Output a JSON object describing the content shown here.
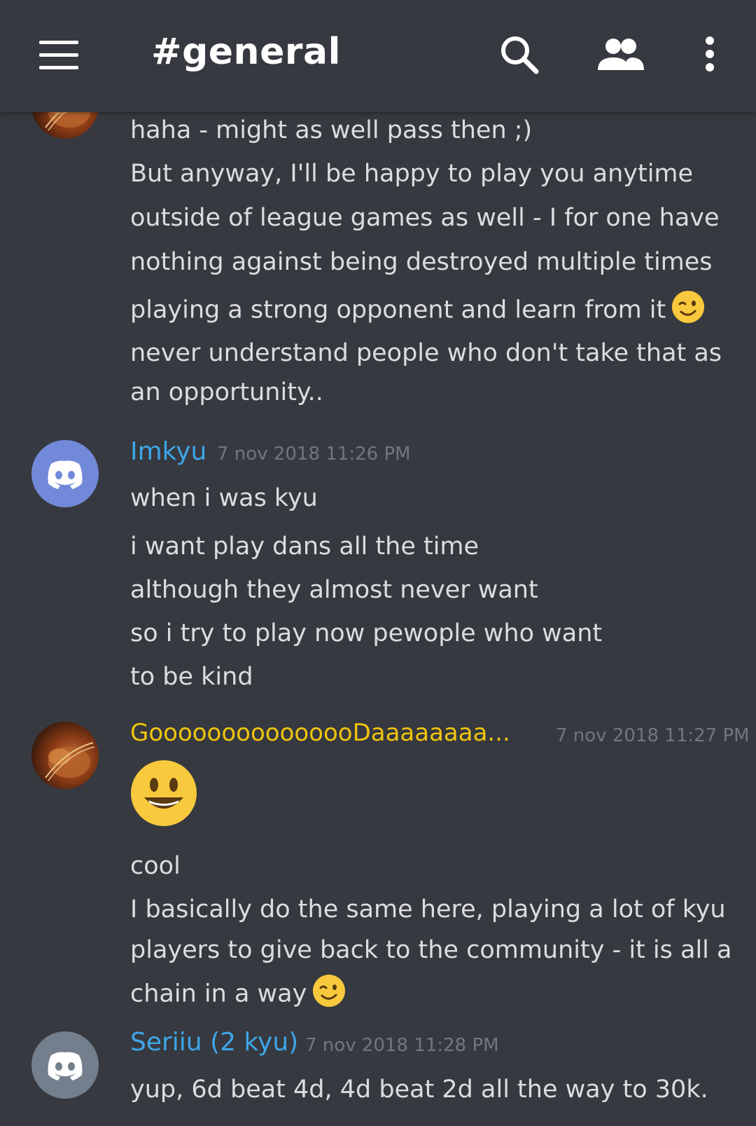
{
  "header": {
    "channel_title": "#general"
  },
  "messages": {
    "group1_lines": [
      "haha - might as well pass then ;)",
      "But anyway, I'll be happy to play you anytime",
      "outside of league games as well - I for one have",
      "nothing against being destroyed multiple times",
      "playing a strong opponent and learn from it",
      "never understand people who don't take that as",
      "an opportunity.."
    ],
    "group2": {
      "username": "Imkyu",
      "timestamp": "7 nov 2018 11:26 PM",
      "lines": [
        "when i was kyu",
        "i want play dans all the time",
        "although they almost never want",
        "so i try to play now pewople who want",
        "to be kind"
      ]
    },
    "group3": {
      "username": "GooooooooooooooDaaaaaaaa...",
      "timestamp": "7 nov 2018 11:27 PM",
      "lines": [
        "cool",
        "I basically do the same here, playing a lot of kyu",
        "players to give back to the community - it is all a",
        "chain in a way"
      ]
    },
    "group4": {
      "username": "Seriiu (2 kyu)",
      "timestamp": "7 nov 2018 11:28 PM",
      "lines": [
        "yup, 6d beat 4d, 4d beat 2d all the way to 30k."
      ]
    }
  },
  "colors": {
    "background": "#36393f",
    "text": "#dcddde",
    "timestamp": "#72767d",
    "username_blue": "#3ea6e8",
    "username_gold": "#f1c40f",
    "discord_blurple": "#7289da"
  },
  "icons": [
    "hamburger-menu-icon",
    "search-icon",
    "members-icon",
    "more-options-icon",
    "winking-face-emoji",
    "smiley-face-emoji",
    "discord-logo-icon"
  ]
}
